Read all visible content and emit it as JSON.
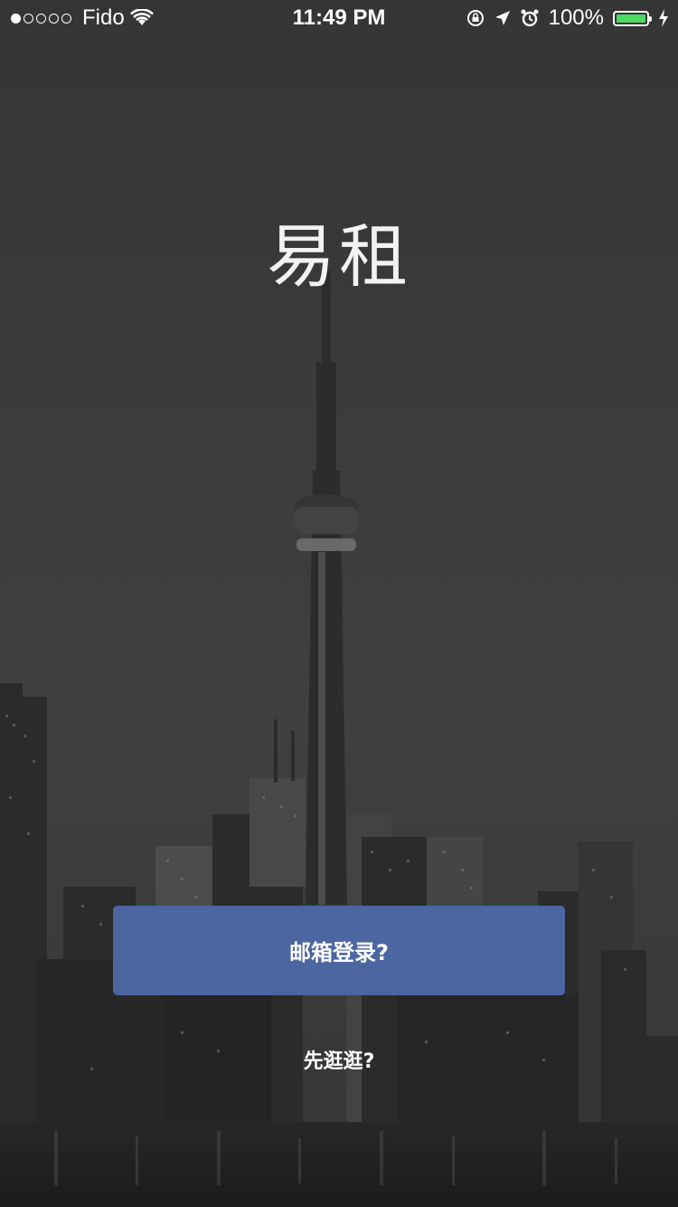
{
  "status_bar": {
    "carrier": "Fido",
    "time": "11:49 PM",
    "battery_percent": "100%",
    "signal_bars_filled": 1,
    "signal_bars_total": 5,
    "icons": [
      "wifi-icon",
      "rotation-lock-icon",
      "location-arrow-icon",
      "alarm-icon",
      "battery-icon",
      "charging-bolt-icon"
    ],
    "battery_color": "#4cd964"
  },
  "app": {
    "title": "易租"
  },
  "actions": {
    "email_login_label": "邮箱登录?",
    "browse_label": "先逛逛?"
  },
  "colors": {
    "primary_button": "#4b66a0",
    "text": "#ffffff"
  }
}
